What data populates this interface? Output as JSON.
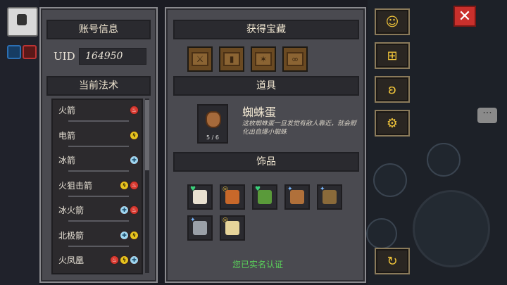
{
  "account": {
    "header": "账号信息",
    "uid_label": "UID",
    "uid_value": "164950"
  },
  "spells": {
    "header": "当前法术",
    "items": [
      {
        "name": "火箭",
        "elements": [
          "fire"
        ]
      },
      {
        "name": "电箭",
        "elements": [
          "bolt"
        ]
      },
      {
        "name": "冰箭",
        "elements": [
          "ice"
        ]
      },
      {
        "name": "火狙击箭",
        "elements": [
          "bolt",
          "fire"
        ]
      },
      {
        "name": "冰火箭",
        "elements": [
          "ice",
          "fire"
        ]
      },
      {
        "name": "北极箭",
        "elements": [
          "ice",
          "bolt"
        ]
      },
      {
        "name": "火凤凰",
        "elements": [
          "fire",
          "bolt",
          "ice"
        ]
      }
    ]
  },
  "treasure": {
    "header": "获得宝藏",
    "chests": [
      "chest-1",
      "chest-2",
      "chest-3",
      "chest-4"
    ]
  },
  "props": {
    "header": "道具",
    "item_name": "蜘蛛蛋",
    "item_desc": "这枚蜘蛛蛋一旦发觉有敌人靠近，就会孵化出自爆小蜘蛛",
    "item_count": "5 / 6"
  },
  "accessories": {
    "header": "饰品",
    "items": [
      {
        "icon": "horn-icon",
        "badge": "heart",
        "color": "#e8e0d0"
      },
      {
        "icon": "vest-icon",
        "badge": "ring",
        "color": "#c8682a"
      },
      {
        "icon": "vine-icon",
        "badge": "heart",
        "color": "#5a9a3a"
      },
      {
        "icon": "hammer-icon",
        "badge": "star",
        "color": "#b0703a"
      },
      {
        "icon": "backpack-icon",
        "badge": "star",
        "color": "#8a6a3a"
      },
      {
        "icon": "skull-amulet-icon",
        "badge": "star",
        "color": "#9aa0a8"
      },
      {
        "icon": "treasure-map-icon",
        "badge": "ring",
        "color": "#e6d49a"
      }
    ]
  },
  "status": {
    "verified": "您已实名认证"
  },
  "side_buttons": [
    {
      "name": "support-button",
      "icon": "headset-icon",
      "glyph": "☺"
    },
    {
      "name": "gift-button",
      "icon": "gift-icon",
      "glyph": "⊞"
    },
    {
      "name": "community-button",
      "icon": "bird-icon",
      "glyph": "ʚ"
    },
    {
      "name": "settings-button",
      "icon": "gear-icon",
      "glyph": "⚙"
    },
    {
      "name": "refresh-button",
      "icon": "refresh-icon",
      "glyph": "↻"
    }
  ],
  "colors": {
    "verified_text": "#5ad15a",
    "close_button": "#c9302c",
    "side_button_glyph": "#f0c43a"
  }
}
